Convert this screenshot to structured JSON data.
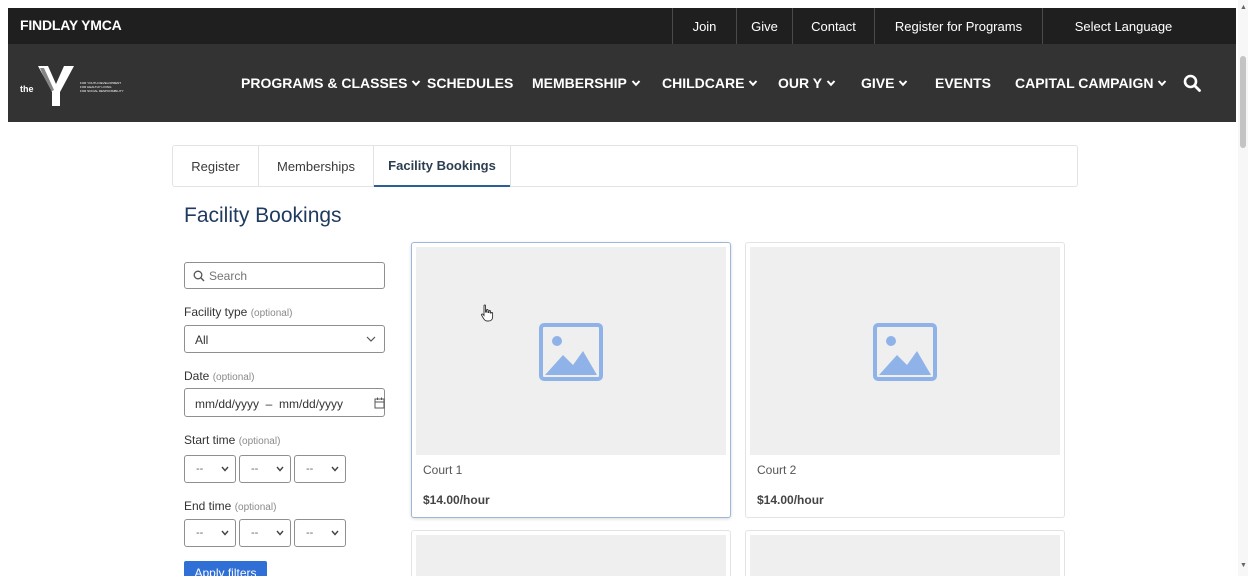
{
  "header": {
    "brand": "FINDLAY YMCA",
    "util_links": [
      "Join",
      "Give",
      "Contact",
      "Register for Programs",
      "Select Language"
    ]
  },
  "logo": {
    "text": "the",
    "tagline": [
      "FOR YOUTH DEVELOPMENT",
      "FOR HEALTHY LIVING",
      "FOR SOCIAL RESPONSIBILITY"
    ]
  },
  "nav": {
    "items": [
      {
        "label": "PROGRAMS & CLASSES"
      },
      {
        "label": "SCHEDULES"
      },
      {
        "label": "MEMBERSHIP"
      },
      {
        "label": "CHILDCARE"
      },
      {
        "label": "OUR Y"
      },
      {
        "label": "GIVE"
      },
      {
        "label": "EVENTS"
      },
      {
        "label": "CAPITAL CAMPAIGN"
      }
    ],
    "search_icon": "search-icon"
  },
  "tabs": [
    "Register",
    "Memberships",
    "Facility Bookings"
  ],
  "active_tab": "Facility Bookings",
  "page": {
    "title": "Facility Bookings"
  },
  "filters": {
    "search_placeholder": "Search",
    "facility_type": {
      "label": "Facility type",
      "optional": "(optional)",
      "value": "All"
    },
    "date": {
      "label": "Date",
      "optional": "(optional)",
      "value": "mm/dd/yyyy  –  mm/dd/yyyy"
    },
    "start_time": {
      "label": "Start time",
      "optional": "(optional)",
      "values": [
        "--",
        "--",
        "--"
      ]
    },
    "end_time": {
      "label": "End time",
      "optional": "(optional)",
      "values": [
        "--",
        "--",
        "--"
      ]
    },
    "apply_label": "Apply filters"
  },
  "facilities": [
    {
      "name": "Court 1",
      "price": "$14.00/hour"
    },
    {
      "name": "Court 2",
      "price": "$14.00/hour"
    }
  ],
  "colors": {
    "topbar": "#1f1f1f",
    "nav": "#333333",
    "accent": "#2f6fd6",
    "title": "#1f3a5f",
    "placeholder_icon": "#8fb3e8"
  }
}
